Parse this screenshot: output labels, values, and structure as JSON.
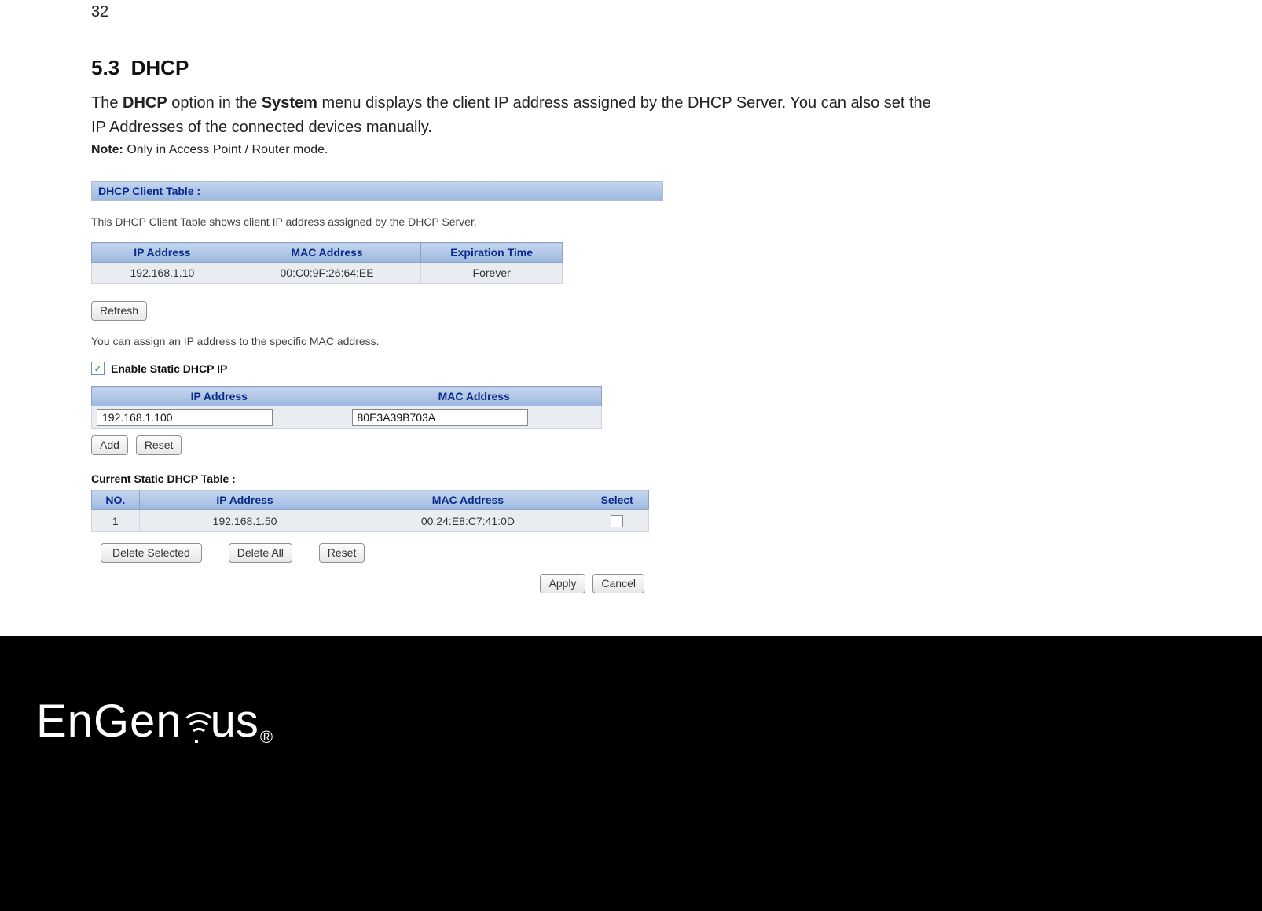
{
  "page_number": "32",
  "section": {
    "number": "5.3",
    "title": "DHCP",
    "intro_pre": "The ",
    "intro_b1": "DHCP",
    "intro_mid": " option in the ",
    "intro_b2": "System",
    "intro_post": " menu displays the client IP address assigned by the DHCP Server. You can also set the IP Addresses of the connected devices manually.",
    "note_label": "Note:",
    "note_text": " Only in Access Point / Router mode."
  },
  "dhcp_client_table": {
    "header": "DHCP Client Table :",
    "description": "This DHCP Client Table shows client IP address assigned by the DHCP Server.",
    "columns": {
      "ip": "IP Address",
      "mac": "MAC Address",
      "exp": "Expiration Time"
    },
    "rows": [
      {
        "ip": "192.168.1.10",
        "mac": "00:C0:9F:26:64:EE",
        "exp": "Forever"
      }
    ],
    "refresh_label": "Refresh"
  },
  "static_assign": {
    "description": "You can assign an IP address to the specific MAC address.",
    "checkbox_label": "Enable Static DHCP IP",
    "checkbox_checked": true,
    "columns": {
      "ip": "IP Address",
      "mac": "MAC Address"
    },
    "inputs": {
      "ip": "192.168.1.100",
      "mac": "80E3A39B703A"
    },
    "add_label": "Add",
    "reset_label": "Reset"
  },
  "static_table": {
    "header": "Current Static DHCP Table :",
    "columns": {
      "no": "NO.",
      "ip": "IP Address",
      "mac": "MAC Address",
      "select": "Select"
    },
    "rows": [
      {
        "no": "1",
        "ip": "192.168.1.50",
        "mac": "00:24:E8:C7:41:0D",
        "selected": false
      }
    ],
    "delete_selected_label": "Delete Selected",
    "delete_all_label": "Delete All",
    "reset_label": "Reset",
    "apply_label": "Apply",
    "cancel_label": "Cancel"
  },
  "brand": {
    "name_part1": "EnGen",
    "name_part2": "us",
    "registered": "®"
  }
}
